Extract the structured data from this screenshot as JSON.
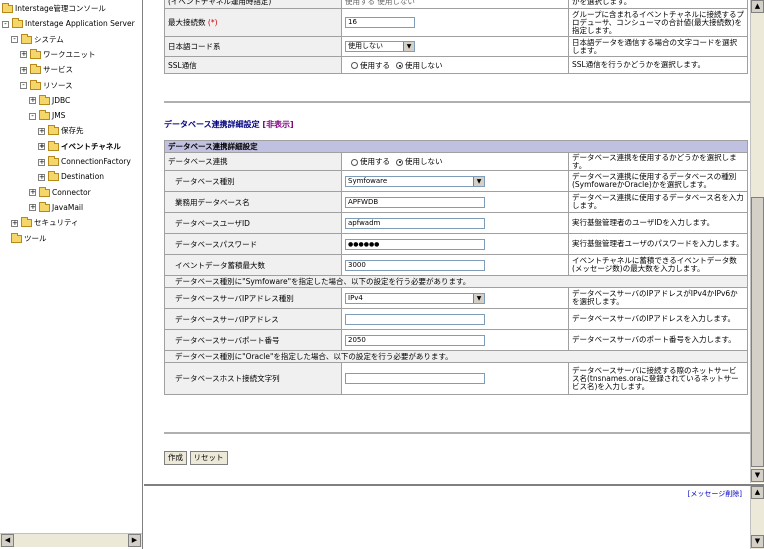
{
  "tree": {
    "items": [
      {
        "label": "Interstage管理コンソール",
        "level": 0,
        "expander": ""
      },
      {
        "label": "Interstage Application Server",
        "level": 0,
        "expander": "-"
      },
      {
        "label": "システム",
        "level": 1,
        "expander": "-"
      },
      {
        "label": "ワークユニット",
        "level": 2,
        "expander": "+"
      },
      {
        "label": "サービス",
        "level": 2,
        "expander": "+"
      },
      {
        "label": "リソース",
        "level": 2,
        "expander": "-"
      },
      {
        "label": "JDBC",
        "level": 3,
        "expander": "+"
      },
      {
        "label": "JMS",
        "level": 3,
        "expander": "-"
      },
      {
        "label": "保存先",
        "level": 4,
        "expander": "+"
      },
      {
        "label": "イベントチャネル",
        "level": 4,
        "expander": "+"
      },
      {
        "label": "ConnectionFactory",
        "level": 4,
        "expander": "+"
      },
      {
        "label": "Destination",
        "level": 4,
        "expander": "+"
      },
      {
        "label": "Connector",
        "level": 3,
        "expander": "+"
      },
      {
        "label": "JavaMail",
        "level": 3,
        "expander": "+"
      },
      {
        "label": "セキュリティ",
        "level": 1,
        "expander": "+"
      },
      {
        "label": "ツール",
        "level": 1,
        "expander": ""
      }
    ]
  },
  "top_table": {
    "row0": {
      "label": "(イベントチャネル運用時指定)",
      "value": "使用する  使用しない",
      "desc": "かを選択します。"
    },
    "max_connections": {
      "label": "最大接続数",
      "required": "(*)",
      "value": "16",
      "desc": "グループに含まれるイベントチャネルに接続するプロデューサ、コンシューマの合計値(最大接続数)を指定します。"
    },
    "jp_code": {
      "label": "日本語コード系",
      "value": "使用しない",
      "desc": "日本語データを通信する場合の文字コードを選択します。"
    },
    "ssl": {
      "label": "SSL通信",
      "opt1": "使用する",
      "opt2": "使用しない",
      "desc": "SSL通信を行うかどうかを選択します。"
    }
  },
  "section": {
    "title": "データベース連携詳細設定",
    "toggle": "[非表示]"
  },
  "db_table": {
    "header": "データベース連携詳細設定",
    "db_link": {
      "label": "データベース連携",
      "opt1": "使用する",
      "opt2": "使用しない",
      "desc": "データベース連携を使用するかどうかを選択します。"
    },
    "db_type": {
      "label": "データベース種別",
      "value": "Symfoware",
      "desc": "データベース連携に使用するデータベースの種別(SymfowareかOracle)かを選択します。"
    },
    "db_name": {
      "label": "業務用データベース名",
      "value": "APFWDB",
      "desc": "データベース連携に使用するデータベース名を入力します。"
    },
    "db_user": {
      "label": "データベースユーザID",
      "value": "apfwadm",
      "desc": "実行基盤管理者のユーザIDを入力します。"
    },
    "db_pass": {
      "label": "データベースパスワード",
      "value": "●●●●●●",
      "desc": "実行基盤管理者ユーザのパスワードを入力します。"
    },
    "event_max": {
      "label": "イベントデータ蓄積最大数",
      "value": "3000",
      "desc": "イベントチャネルに蓄積できるイベントデータ数(メッセージ数)の最大数を入力します。"
    },
    "note_symfoware": "データベース種別に\"Symfoware\"を指定した場合、以下の設定を行う必要があります。",
    "ip_type": {
      "label": "データベースサーバIPアドレス種別",
      "value": "IPv4",
      "desc": "データベースサーバのIPアドレスがIPv4かIPv6かを選択します。"
    },
    "ip_addr": {
      "label": "データベースサーバIPアドレス",
      "value": "",
      "desc": "データベースサーバのIPアドレスを入力します。"
    },
    "port": {
      "label": "データベースサーバポート番号",
      "value": "2050",
      "desc": "データベースサーバのポート番号を入力します。"
    },
    "note_oracle": "データベース種別に\"Oracle\"を指定した場合、以下の設定を行う必要があります。",
    "host": {
      "label": "データベースホスト接続文字列",
      "value": "",
      "desc": "データベースサーバに接続する際のネットサービス名(tnsnames.oraに登録されているネットサービス名)を入力します。"
    }
  },
  "buttons": {
    "create": "作成",
    "reset": "リセット"
  },
  "message": {
    "clear_link": "[メッセージ削除]"
  }
}
